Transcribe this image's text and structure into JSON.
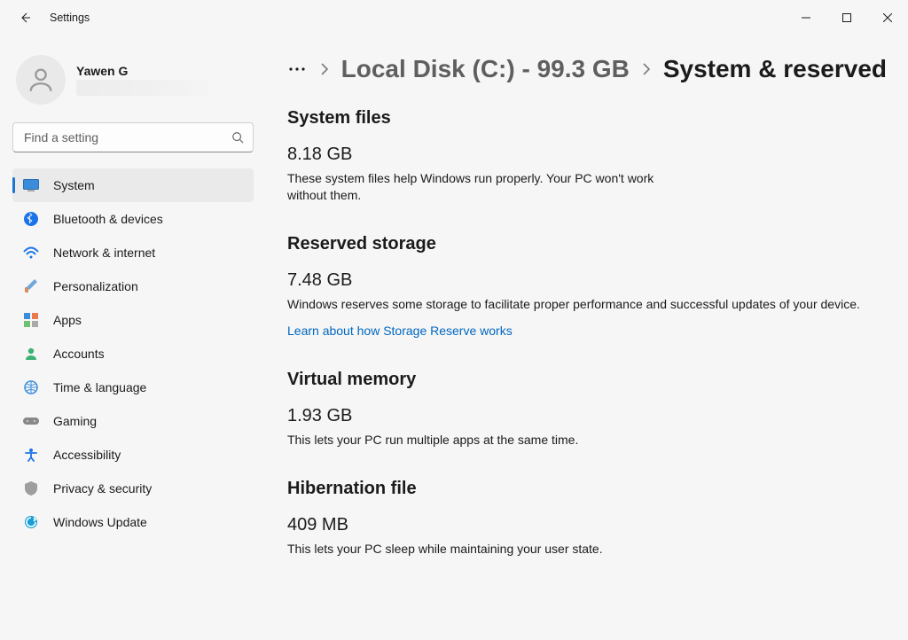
{
  "window": {
    "title": "Settings"
  },
  "user": {
    "name": "Yawen G"
  },
  "search": {
    "placeholder": "Find a setting"
  },
  "nav": {
    "items": [
      {
        "id": "system",
        "label": "System",
        "active": true
      },
      {
        "id": "bluetooth",
        "label": "Bluetooth & devices"
      },
      {
        "id": "network",
        "label": "Network & internet"
      },
      {
        "id": "personalization",
        "label": "Personalization"
      },
      {
        "id": "apps",
        "label": "Apps"
      },
      {
        "id": "accounts",
        "label": "Accounts"
      },
      {
        "id": "time",
        "label": "Time & language"
      },
      {
        "id": "gaming",
        "label": "Gaming"
      },
      {
        "id": "accessibility",
        "label": "Accessibility"
      },
      {
        "id": "privacy",
        "label": "Privacy & security"
      },
      {
        "id": "update",
        "label": "Windows Update"
      }
    ]
  },
  "breadcrumb": {
    "parent": "Local Disk (C:) - 99.3 GB",
    "current": "System & reserved"
  },
  "sections": {
    "system_files": {
      "heading": "System files",
      "value": "8.18 GB",
      "desc": "These system files help Windows run properly. Your PC won't work without them."
    },
    "reserved": {
      "heading": "Reserved storage",
      "value": "7.48 GB",
      "desc": "Windows reserves some storage to facilitate proper performance and successful updates of your device.",
      "link": "Learn about how Storage Reserve works"
    },
    "virtual_memory": {
      "heading": "Virtual memory",
      "value": "1.93 GB",
      "desc": "This lets your PC run multiple apps at the same time."
    },
    "hibernation": {
      "heading": "Hibernation file",
      "value": "409 MB",
      "desc": "This lets your PC sleep while maintaining your user state."
    }
  }
}
